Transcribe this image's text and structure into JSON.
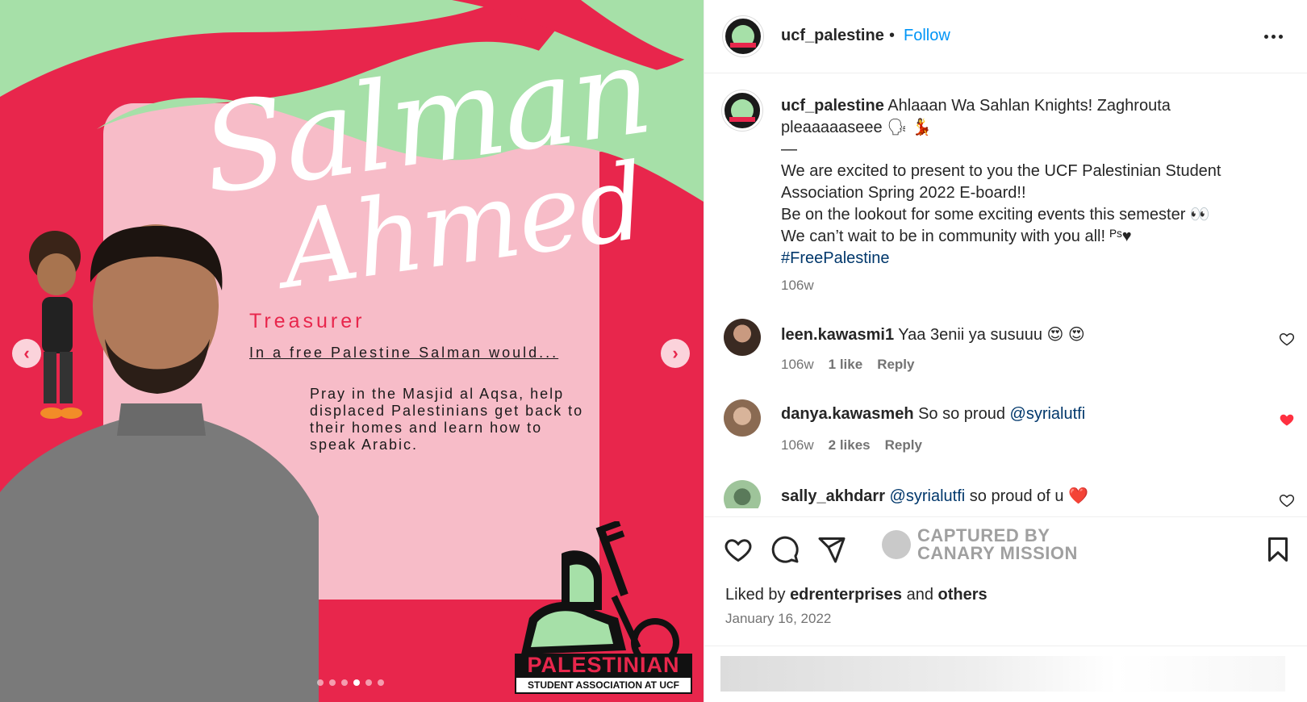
{
  "post_image": {
    "name_first": "Salman",
    "name_last": "Ahmed",
    "role": "Treasurer",
    "prompt": "In a free Palestine Salman would...",
    "answer": "Pray in the Masjid al Aqsa, help displaced Palestinians get back to their homes and learn how to speak Arabic.",
    "logo_title": "PALESTINIAN",
    "logo_subtitle": "STUDENT ASSOCIATION AT UCF",
    "prev_glyph": "‹",
    "next_glyph": "›",
    "carousel": {
      "count": 6,
      "active_index": 3
    }
  },
  "header": {
    "username": "ucf_palestine",
    "separator": "•",
    "follow_label": "Follow"
  },
  "caption": {
    "username": "ucf_palestine",
    "line1": "Ahlaaan Wa Sahlan Knights! Zaghrouta pleaaaaaseee 🗣 💃",
    "dash": "—",
    "line2": "We are excited to present to you the UCF Palestinian Student Association Spring 2022 E-board!!",
    "line3": "Be on the lookout for some exciting events this semester 👀",
    "line4": "We can’t wait to be in community with you all! ᴾˢ♥",
    "hashtag": "#FreePalestine",
    "time": "106w"
  },
  "comments": [
    {
      "username": "leen.kawasmi1",
      "mention": "",
      "text": "Yaa 3enii ya susuuu 😍 😍",
      "time": "106w",
      "likes": "1 like",
      "reply": "Reply",
      "liked": false
    },
    {
      "username": "danya.kawasmeh",
      "mention": "@syrialutfi",
      "text": "So so proud",
      "time": "106w",
      "likes": "2 likes",
      "reply": "Reply",
      "liked": true
    },
    {
      "username": "sally_akhdarr",
      "mention": "@syrialutfi",
      "text": "so proud of u ❤️",
      "time": "",
      "likes": "",
      "reply": "",
      "liked": false
    }
  ],
  "actions": {
    "watermark_line1": "CAPTURED BY",
    "watermark_line2": "CANARY MISSION",
    "liked_by_prefix": "Liked by",
    "liked_by_user": "edrenterprises",
    "liked_by_and": "and",
    "liked_by_others": "others",
    "date": "January 16, 2022"
  },
  "colors": {
    "brand_red": "#e8264c",
    "mint_green": "#a6e0a8",
    "pink_panel": "#f7bcc8",
    "follow_blue": "#0095f6",
    "heart_red": "#ff3040"
  }
}
